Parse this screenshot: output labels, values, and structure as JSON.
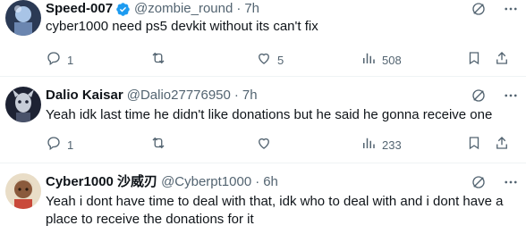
{
  "tweets": [
    {
      "name": "Speed-007",
      "handle": "@zombie_round",
      "dot": "·",
      "time": "7h",
      "verified": true,
      "text": "cyber1000 need ps5 devkit without its can't fix",
      "replies": "1",
      "retweets": "",
      "likes": "5",
      "views": "508"
    },
    {
      "name": "Dalio Kaisar",
      "handle": "@Dalio27776950",
      "dot": "·",
      "time": "7h",
      "verified": false,
      "text": "Yeah idk last time he didn't like donations but he said he gonna receive one",
      "replies": "1",
      "retweets": "",
      "likes": "",
      "views": "233"
    },
    {
      "name": "Cyber1000 沙威刃",
      "handle": "@Cyberpt1000",
      "dot": "·",
      "time": "6h",
      "verified": false,
      "text": "Yeah i dont have time to deal with that, idk who to deal with and i dont have a place to receive the donations for it"
    }
  ],
  "colors": {
    "text": "#0f1419",
    "secondary": "#536471",
    "verified": "#1d9bf0",
    "border": "#eff3f4"
  },
  "icons": [
    "reply-icon",
    "retweet-icon",
    "like-icon",
    "views-icon",
    "bookmark-icon",
    "share-icon",
    "grok-icon",
    "more-icon",
    "verified-badge-icon"
  ]
}
